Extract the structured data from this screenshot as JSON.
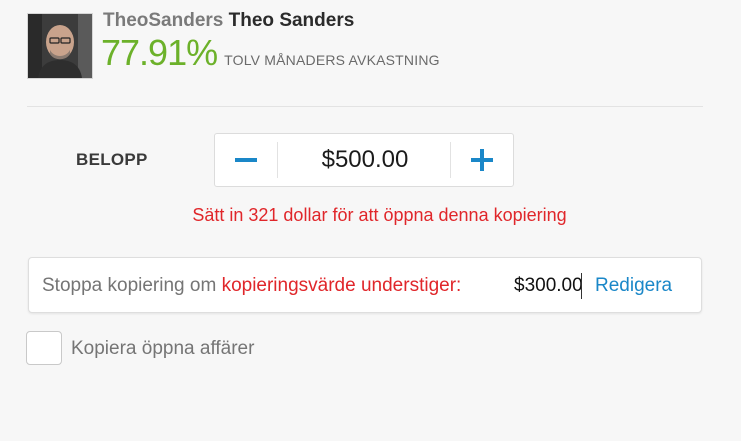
{
  "trader": {
    "username": "TheoSanders",
    "full_name": "Theo Sanders",
    "gain": "77.91%",
    "gain_label": "TOLV MÅNADERS AVKASTNING"
  },
  "amount": {
    "label": "BELOPP",
    "value": "$500.00",
    "minus_symbol": "−",
    "plus_symbol": "+"
  },
  "deposit_message": "Sätt in 321 dollar för att öppna denna kopiering",
  "stop_copy": {
    "prefix": "Stoppa kopiering om ",
    "highlight": "kopieringsvärde understiger:",
    "value": "$300.00",
    "edit_label": "Redigera"
  },
  "copy_open_trades": {
    "label": "Kopiera öppna affärer",
    "checked": false
  },
  "colors": {
    "accent_blue": "#1a87c8",
    "gain_green": "#6cb12a",
    "error_red": "#e0262a"
  }
}
